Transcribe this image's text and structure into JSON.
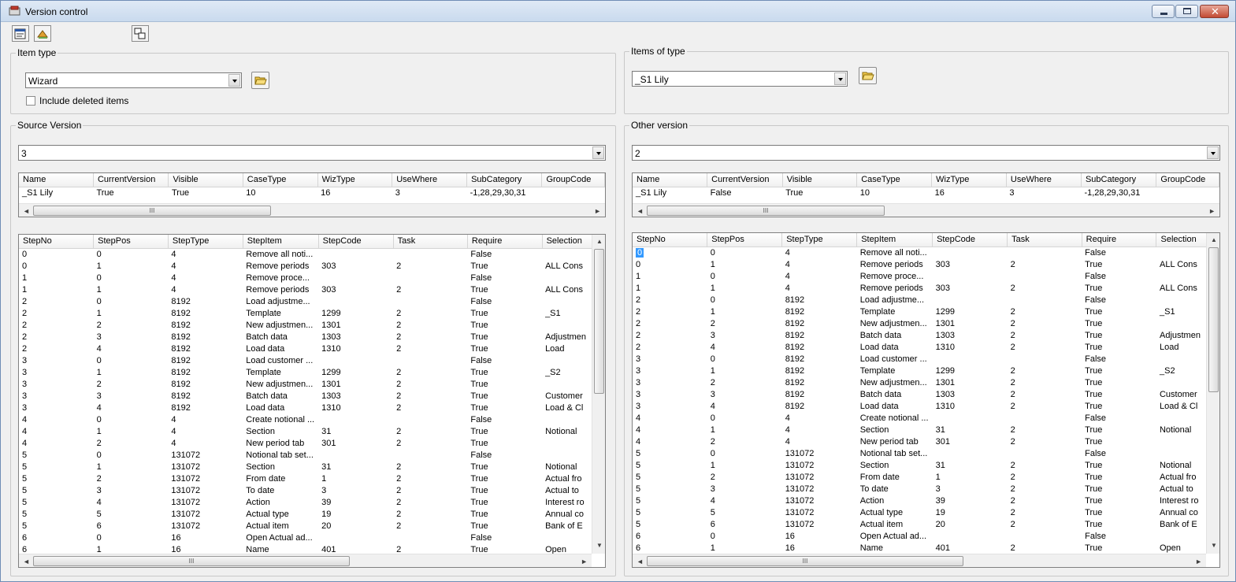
{
  "window": {
    "title": "Version control"
  },
  "item_type": {
    "legend": "Item type",
    "selected": "Wizard",
    "include_deleted_label": "Include deleted items"
  },
  "items_of_type": {
    "legend": "Items of type",
    "selected": "_S1 Lily"
  },
  "source": {
    "legend": "Source Version",
    "version": "3",
    "summary_columns": [
      "Name",
      "CurrentVersion",
      "Visible",
      "CaseType",
      "WizType",
      "UseWhere",
      "SubCategory",
      "GroupCode"
    ],
    "summary_rows": [
      [
        "_S1 Lily",
        "True",
        "True",
        "10",
        "16",
        "3",
        "-1,28,29,30,31",
        ""
      ]
    ],
    "step_columns": [
      "StepNo",
      "StepPos",
      "StepType",
      "StepItem",
      "StepCode",
      "Task",
      "Require",
      "Selection"
    ],
    "step_rows": [
      [
        "0",
        "0",
        "4",
        "Remove all noti...",
        "",
        "",
        "False",
        ""
      ],
      [
        "0",
        "1",
        "4",
        "Remove periods",
        "303",
        "2",
        "True",
        "ALL Cons"
      ],
      [
        "1",
        "0",
        "4",
        "Remove proce...",
        "",
        "",
        "False",
        ""
      ],
      [
        "1",
        "1",
        "4",
        "Remove periods",
        "303",
        "2",
        "True",
        "ALL Cons"
      ],
      [
        "2",
        "0",
        "8192",
        "Load adjustme...",
        "",
        "",
        "False",
        ""
      ],
      [
        "2",
        "1",
        "8192",
        "Template",
        "1299",
        "2",
        "True",
        "_S1"
      ],
      [
        "2",
        "2",
        "8192",
        "New adjustmen...",
        "1301",
        "2",
        "True",
        ""
      ],
      [
        "2",
        "3",
        "8192",
        "Batch data",
        "1303",
        "2",
        "True",
        "Adjustmen"
      ],
      [
        "2",
        "4",
        "8192",
        "Load data",
        "1310",
        "2",
        "True",
        "Load"
      ],
      [
        "3",
        "0",
        "8192",
        "Load customer ...",
        "",
        "",
        "False",
        ""
      ],
      [
        "3",
        "1",
        "8192",
        "Template",
        "1299",
        "2",
        "True",
        "_S2"
      ],
      [
        "3",
        "2",
        "8192",
        "New adjustmen...",
        "1301",
        "2",
        "True",
        ""
      ],
      [
        "3",
        "3",
        "8192",
        "Batch data",
        "1303",
        "2",
        "True",
        "Customer"
      ],
      [
        "3",
        "4",
        "8192",
        "Load data",
        "1310",
        "2",
        "True",
        "Load & Cl"
      ],
      [
        "4",
        "0",
        "4",
        "Create notional ...",
        "",
        "",
        "False",
        ""
      ],
      [
        "4",
        "1",
        "4",
        "Section",
        "31",
        "2",
        "True",
        "Notional"
      ],
      [
        "4",
        "2",
        "4",
        "New period tab",
        "301",
        "2",
        "True",
        ""
      ],
      [
        "5",
        "0",
        "131072",
        "Notional tab set...",
        "",
        "",
        "False",
        ""
      ],
      [
        "5",
        "1",
        "131072",
        "Section",
        "31",
        "2",
        "True",
        "Notional"
      ],
      [
        "5",
        "2",
        "131072",
        "From date",
        "1",
        "2",
        "True",
        "Actual fro"
      ],
      [
        "5",
        "3",
        "131072",
        "To date",
        "3",
        "2",
        "True",
        "Actual to"
      ],
      [
        "5",
        "4",
        "131072",
        "Action",
        "39",
        "2",
        "True",
        "Interest ro"
      ],
      [
        "5",
        "5",
        "131072",
        "Actual type",
        "19",
        "2",
        "True",
        "Annual co"
      ],
      [
        "5",
        "6",
        "131072",
        "Actual item",
        "20",
        "2",
        "True",
        "Bank of E"
      ],
      [
        "6",
        "0",
        "16",
        "Open Actual ad...",
        "",
        "",
        "False",
        ""
      ],
      [
        "6",
        "1",
        "16",
        "Name",
        "401",
        "2",
        "True",
        "Open"
      ]
    ]
  },
  "other": {
    "legend": "Other version",
    "version": "2",
    "summary_columns": [
      "Name",
      "CurrentVersion",
      "Visible",
      "CaseType",
      "WizType",
      "UseWhere",
      "SubCategory",
      "GroupCode"
    ],
    "summary_rows": [
      [
        "_S1 Lily",
        "False",
        "True",
        "10",
        "16",
        "3",
        "-1,28,29,30,31",
        ""
      ]
    ],
    "step_columns": [
      "StepNo",
      "StepPos",
      "StepType",
      "StepItem",
      "StepCode",
      "Task",
      "Require",
      "Selection"
    ],
    "step_rows": [
      [
        "0",
        "0",
        "4",
        "Remove all noti...",
        "",
        "",
        "False",
        ""
      ],
      [
        "0",
        "1",
        "4",
        "Remove periods",
        "303",
        "2",
        "True",
        "ALL Cons"
      ],
      [
        "1",
        "0",
        "4",
        "Remove proce...",
        "",
        "",
        "False",
        ""
      ],
      [
        "1",
        "1",
        "4",
        "Remove periods",
        "303",
        "2",
        "True",
        "ALL Cons"
      ],
      [
        "2",
        "0",
        "8192",
        "Load adjustme...",
        "",
        "",
        "False",
        ""
      ],
      [
        "2",
        "1",
        "8192",
        "Template",
        "1299",
        "2",
        "True",
        "_S1"
      ],
      [
        "2",
        "2",
        "8192",
        "New adjustmen...",
        "1301",
        "2",
        "True",
        ""
      ],
      [
        "2",
        "3",
        "8192",
        "Batch data",
        "1303",
        "2",
        "True",
        "Adjustmen"
      ],
      [
        "2",
        "4",
        "8192",
        "Load data",
        "1310",
        "2",
        "True",
        "Load"
      ],
      [
        "3",
        "0",
        "8192",
        "Load customer ...",
        "",
        "",
        "False",
        ""
      ],
      [
        "3",
        "1",
        "8192",
        "Template",
        "1299",
        "2",
        "True",
        "_S2"
      ],
      [
        "3",
        "2",
        "8192",
        "New adjustmen...",
        "1301",
        "2",
        "True",
        ""
      ],
      [
        "3",
        "3",
        "8192",
        "Batch data",
        "1303",
        "2",
        "True",
        "Customer"
      ],
      [
        "3",
        "4",
        "8192",
        "Load data",
        "1310",
        "2",
        "True",
        "Load & Cl"
      ],
      [
        "4",
        "0",
        "4",
        "Create notional ...",
        "",
        "",
        "False",
        ""
      ],
      [
        "4",
        "1",
        "4",
        "Section",
        "31",
        "2",
        "True",
        "Notional"
      ],
      [
        "4",
        "2",
        "4",
        "New period tab",
        "301",
        "2",
        "True",
        ""
      ],
      [
        "5",
        "0",
        "131072",
        "Notional tab set...",
        "",
        "",
        "False",
        ""
      ],
      [
        "5",
        "1",
        "131072",
        "Section",
        "31",
        "2",
        "True",
        "Notional"
      ],
      [
        "5",
        "2",
        "131072",
        "From date",
        "1",
        "2",
        "True",
        "Actual fro"
      ],
      [
        "5",
        "3",
        "131072",
        "To date",
        "3",
        "2",
        "True",
        "Actual to"
      ],
      [
        "5",
        "4",
        "131072",
        "Action",
        "39",
        "2",
        "True",
        "Interest ro"
      ],
      [
        "5",
        "5",
        "131072",
        "Actual type",
        "19",
        "2",
        "True",
        "Annual co"
      ],
      [
        "5",
        "6",
        "131072",
        "Actual item",
        "20",
        "2",
        "True",
        "Bank of E"
      ],
      [
        "6",
        "0",
        "16",
        "Open Actual ad...",
        "",
        "",
        "False",
        ""
      ],
      [
        "6",
        "1",
        "16",
        "Name",
        "401",
        "2",
        "True",
        "Open"
      ]
    ]
  },
  "colors": {
    "selection": "#3399ff",
    "titlebar": "#c9daee",
    "close_button": "#c24a33"
  },
  "icons": [
    "app-icon",
    "properties-icon",
    "open-tool-icon",
    "compare-icon",
    "folder-open-icon",
    "minimize-icon",
    "maximize-icon",
    "close-icon"
  ]
}
